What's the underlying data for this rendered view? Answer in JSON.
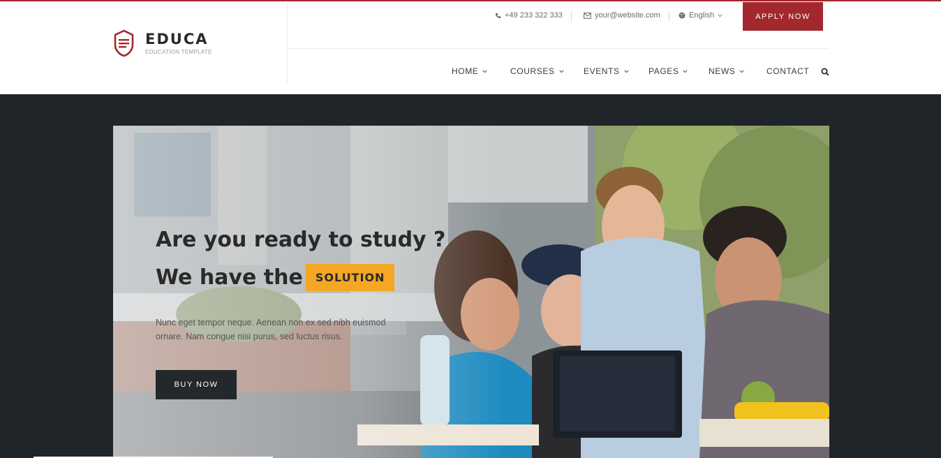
{
  "brand": {
    "name": "EDUCA",
    "tagline": "EDUCATION TEMPLATE",
    "accent_color": "#a3282e",
    "badge_color": "#f5a623"
  },
  "topbar": {
    "phone": "+49 233 322 333",
    "email": "your@website.com",
    "language": "English",
    "apply_label": "APPLY NOW"
  },
  "nav": {
    "items": [
      {
        "label": "HOME",
        "has_dropdown": true
      },
      {
        "label": "COURSES",
        "has_dropdown": true
      },
      {
        "label": "EVENTS",
        "has_dropdown": true
      },
      {
        "label": "PAGES",
        "has_dropdown": true
      },
      {
        "label": "NEWS",
        "has_dropdown": true
      },
      {
        "label": "CONTACT",
        "has_dropdown": false
      }
    ],
    "search_icon": "search-icon"
  },
  "hero": {
    "title_line1": "Are you ready to study ?",
    "title_line2": "We have the",
    "badge": "SOLUTION",
    "description": "Nunc eget tempor neque. Aenean non ex sed nibh euismod ornare. Nam congue nisi purus, sed luctus risus.",
    "button_label": "BUY NOW"
  }
}
